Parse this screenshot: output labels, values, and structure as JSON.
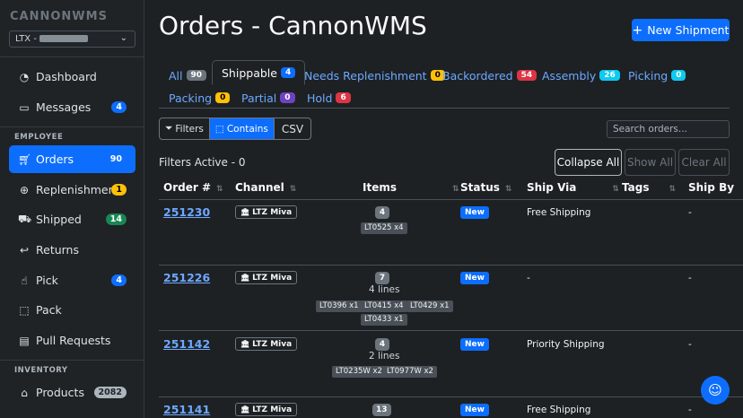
{
  "app": {
    "logo_text": "CANNONWMS",
    "warehouse_prefix": "LTX -"
  },
  "sidebar": {
    "items": [
      {
        "label": "Dashboard",
        "icon": "gauge-icon"
      },
      {
        "label": "Messages",
        "icon": "chat-icon",
        "badge": "4"
      },
      {
        "label": "Orders",
        "icon": "cart-icon",
        "badge": "90"
      },
      {
        "label": "Replenishment",
        "icon": "arrow-circle-down-icon",
        "badge": "1"
      },
      {
        "label": "Shipped",
        "icon": "truck-icon",
        "badge": "14"
      },
      {
        "label": "Returns",
        "icon": "return-arrow-icon"
      },
      {
        "label": "Pick",
        "icon": "hand-icon",
        "badge": "4"
      },
      {
        "label": "Pack",
        "icon": "box-icon"
      },
      {
        "label": "Pull Requests",
        "icon": "clipboard-icon"
      },
      {
        "label": "Products",
        "icon": "tag-icon",
        "badge": "2082"
      }
    ],
    "section_employee": "EMPLOYEE",
    "section_inventory": "INVENTORY"
  },
  "header": {
    "title": "Orders - CannonWMS",
    "new_shipment": "New Shipment"
  },
  "tabs": [
    {
      "label": "All",
      "count": "90"
    },
    {
      "label": "Shippable",
      "count": "4"
    },
    {
      "label": "Needs Replenishment",
      "count": "0"
    },
    {
      "label": "Backordered",
      "count": "54"
    },
    {
      "label": "Assembly",
      "count": "26"
    },
    {
      "label": "Picking",
      "count": "0"
    },
    {
      "label": "Packing",
      "count": "0"
    },
    {
      "label": "Partial",
      "count": "0"
    },
    {
      "label": "Hold",
      "count": "6"
    }
  ],
  "toolbar": {
    "filters": "Filters",
    "contains": "Contains",
    "csv": "CSV",
    "search_placeholder": "Search orders...",
    "filters_active": "Filters Active - 0",
    "collapse_all": "Collapse All",
    "show_all": "Show All",
    "clear_all": "Clear All"
  },
  "table": {
    "headers": [
      "Order #",
      "Channel",
      "Items",
      "Status",
      "Ship Via",
      "Tags",
      "Ship By"
    ],
    "rows": [
      {
        "order": "251230",
        "channel": "LTZ Miva",
        "qty": "4",
        "lines": "",
        "skus": [
          "LT0525 x4"
        ],
        "status": "New",
        "ship_via": "Free Shipping",
        "ship_by": "-"
      },
      {
        "order": "251226",
        "channel": "LTZ Miva",
        "qty": "7",
        "lines": "4 lines",
        "skus": [
          "LT0396 x1",
          "LT0415 x4",
          "LT0429 x1",
          "LT0433 x1"
        ],
        "status": "New",
        "ship_via": "-",
        "ship_by": "-"
      },
      {
        "order": "251142",
        "channel": "LTZ Miva",
        "qty": "4",
        "lines": "2 lines",
        "skus": [
          "LT0235W x2",
          "LT0977W x2"
        ],
        "status": "New",
        "ship_via": "Priority Shipping",
        "ship_by": "-"
      },
      {
        "order": "251141",
        "channel": "LTZ Miva",
        "qty": "13",
        "lines": "",
        "skus": [],
        "status": "New",
        "ship_via": "Free Shipping",
        "ship_by": "-"
      }
    ]
  },
  "colors": {
    "primary": "#0d6efd",
    "warning": "#ffc107",
    "danger": "#dc3545",
    "purple": "#6f42c1",
    "info": "#0dcaf0",
    "success": "#198754",
    "secondary": "#6c757d"
  }
}
